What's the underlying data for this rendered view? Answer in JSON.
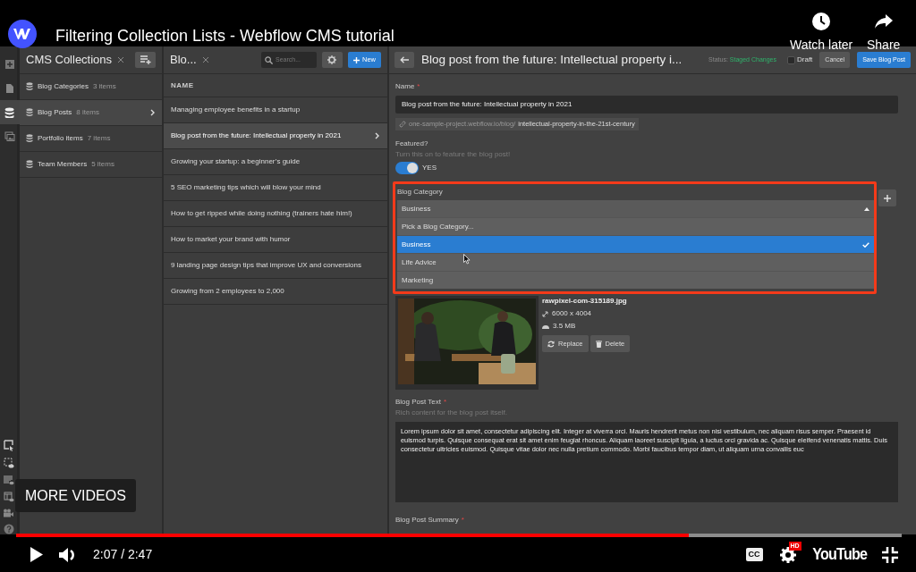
{
  "video": {
    "title": "Filtering Collection Lists - Webflow CMS tutorial",
    "actions": [
      {
        "kind": "clock",
        "label": "Watch later"
      },
      {
        "kind": "share",
        "label": "Share"
      }
    ],
    "more_videos": "MORE VIDEOS",
    "progress": {
      "level": 0.76
    },
    "time": "2:07 / 2:47",
    "cc": "CC",
    "hd": "HD",
    "logo": "YouTube"
  },
  "rail": [
    {
      "kind": "add",
      "selected": false
    },
    {
      "kind": "pages",
      "selected": false
    },
    {
      "kind": "cms",
      "selected": true
    },
    {
      "kind": "assets",
      "selected": false
    }
  ],
  "collections": {
    "title": "CMS Collections",
    "items": [
      {
        "name": "Blog Categories",
        "count": "3 items",
        "selected": false
      },
      {
        "name": "Blog Posts",
        "count": "8 items",
        "selected": true
      },
      {
        "name": "Portfolio items",
        "count": "7 items",
        "selected": false
      },
      {
        "name": "Team Members",
        "count": "5 items",
        "selected": false
      }
    ]
  },
  "posts": {
    "title": "Blo...",
    "search_placeholder": "Search...",
    "new_button": "New",
    "column": "NAME",
    "rows": [
      {
        "name": "Managing employee benefits in a startup",
        "selected": false
      },
      {
        "name": "Blog post from the future: Intellectual property in 2021",
        "selected": true
      },
      {
        "name": "Growing your startup: a beginner’s guide",
        "selected": false
      },
      {
        "name": "5 SEO marketing tips which will blow your mind",
        "selected": false
      },
      {
        "name": "How to get ripped while doing nothing (trainers hate him!)",
        "selected": false
      },
      {
        "name": "How to market your brand with humor",
        "selected": false
      },
      {
        "name": "9 landing page design tips that improve UX and conversions",
        "selected": false
      },
      {
        "name": "Growing from 2 employees to 2,000",
        "selected": false
      }
    ]
  },
  "editor": {
    "title": "Blog post from the future: Intellectual property i...",
    "status_label": "Status:",
    "status": "Staged Changes",
    "draft": {
      "label": "Draft",
      "checked": false
    },
    "cancel": "Cancel",
    "save": "Save Blog Post",
    "name_field": {
      "label": "Name",
      "required_mark": "*",
      "value": "Blog post from the future: Intellectual property in 2021"
    },
    "slug": {
      "base": "one-sample-project.webflow.io/blog/",
      "value": "intellectual-property-in-the-21st-century"
    },
    "featured": {
      "label": "Featured?",
      "hint": "Turn this on to feature the blog post!",
      "on": true,
      "state_text": "YES"
    },
    "category": {
      "label": "Blog Category",
      "value": "Business",
      "expanded": true,
      "options": [
        {
          "label": "Pick a Blog Category...",
          "selected": false
        },
        {
          "label": "Business",
          "selected": true
        },
        {
          "label": "Life Advice",
          "selected": false
        },
        {
          "label": "Marketing",
          "selected": false
        }
      ]
    },
    "image": {
      "filename": "rawpixel-com-315189.jpg",
      "dimensions": "6000 x 4004",
      "size": "3.5 MB",
      "replace": "Replace",
      "delete": "Delete"
    },
    "post_text": {
      "label": "Blog Post Text",
      "required_mark": "*",
      "hint": "Rich content for the blog post itself.",
      "value": "Lorem ipsum dolor sit amet, consectetur adipiscing elit. Integer at viverra orci. Mauris hendrerit metus non nisi vestibulum, nec aliquam risus semper. Praesent id euismod turpis. Quisque consequat erat sit amet enim feugiat rhoncus. Aliquam laoreet suscipit ligula, a luctus orci gravida ac. Quisque eleifend venenatis mattis. Duis consectetur ultricies euismod. Quisque vitae dolor nec nulla pretium commodo. Morbi faucibus tempor diam, ut aliquam urna convallis euc"
    },
    "summary": {
      "label": "Blog Post Summary",
      "required_mark": "*"
    }
  }
}
